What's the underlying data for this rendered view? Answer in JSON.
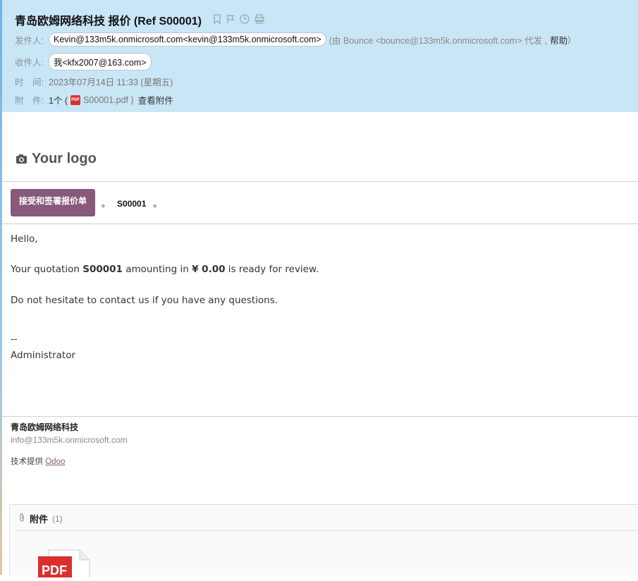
{
  "header": {
    "subject": "青岛欧姆网络科技 报价 (Ref S00001)",
    "icons": [
      "bookmark-icon",
      "flag-icon",
      "clock-icon",
      "print-icon"
    ],
    "from_label": "发件人:",
    "from_value": "Kevin@133m5k.onmicrosoft.com<kevin@133m5k.onmicrosoft.com>",
    "from_via_prefix": "(由 Bounce <bounce@133m5k.onmicrosoft.com> 代发 ,",
    "from_help": "帮助",
    "from_via_suffix": ")",
    "to_label": "收件人:",
    "to_value": "我<kfx2007@163.com>",
    "time_label": "时　间:",
    "time_value": "2023年07月14日 11:33 (星期五)",
    "attach_label": "附　件:",
    "attach_count": "1个 (",
    "attach_file": "S00001.pdf )",
    "attach_view": "查看附件"
  },
  "body": {
    "logo_text": "Your logo",
    "accept_button": "接受和签署报价单",
    "ref_dot1": "。",
    "ref_code": "S00001",
    "ref_dot2": "。",
    "greeting": "Hello,",
    "line1_a": "Your quotation ",
    "line1_code": "S00001",
    "line1_b": " amounting in ",
    "line1_amount": "¥ 0.00",
    "line1_c": " is ready for review.",
    "line2": "Do not hesitate to contact us if you have any questions.",
    "sig_dash": "--",
    "sig_name": "Administrator"
  },
  "footer": {
    "company": "青岛欧姆网络科技",
    "email": "info@133m5k.onmicrosoft.com",
    "powered_prefix": "技术提供 ",
    "powered_link": "Odoo"
  },
  "attachments": {
    "title": "附件",
    "count": "(1)",
    "file_badge": "PDF"
  },
  "colors": {
    "header_bg": "#c9e6f7",
    "accent": "#875a7b",
    "pdf_red": "#d9302e"
  }
}
